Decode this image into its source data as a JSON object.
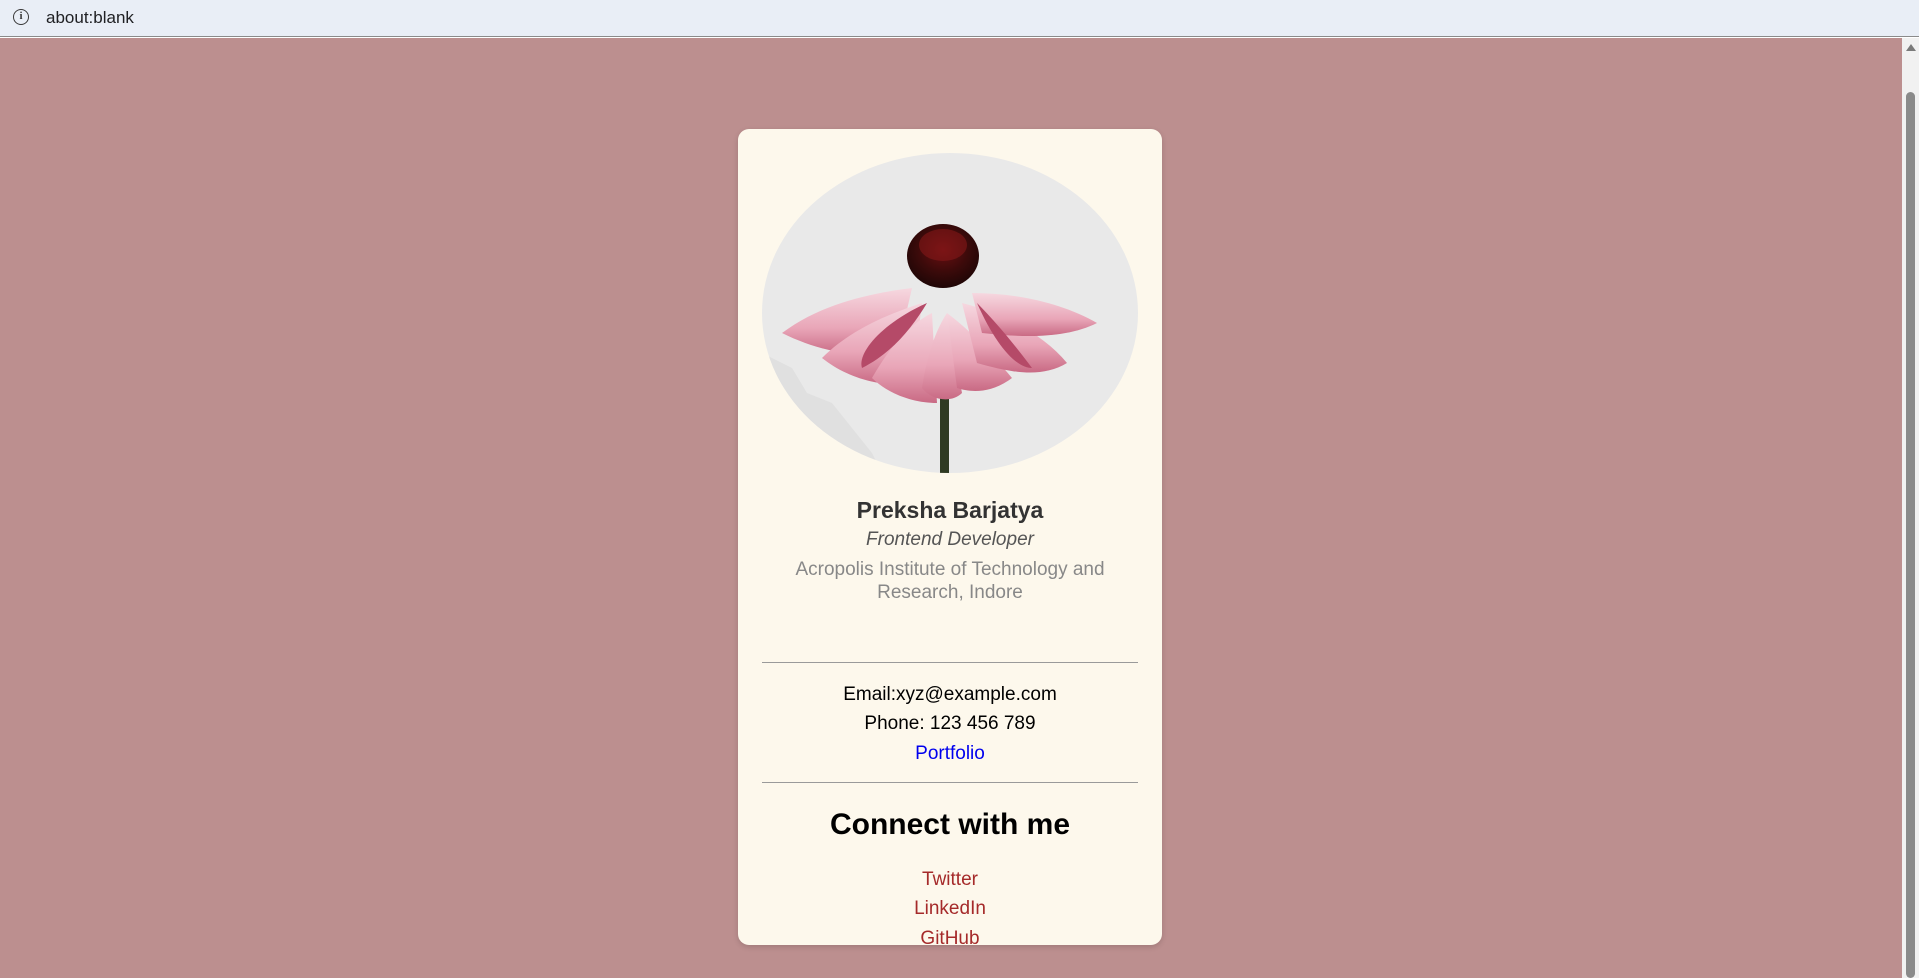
{
  "browser": {
    "address": "about:blank"
  },
  "colors": {
    "page_background": "#bc8f8f",
    "card_background": "#fdf8ec",
    "social_link": "#a52a2a",
    "portfolio_link": "#0000ee"
  },
  "profile": {
    "photo_icon": "flower-photo",
    "name": "Preksha Barjatya",
    "role": "Frontend Developer",
    "institute": "Acropolis Institute of Technology and Research, Indore"
  },
  "contact": {
    "email": "Email:xyz@example.com",
    "phone": "Phone: 123 456 789",
    "portfolio_label": "Portfolio"
  },
  "social": {
    "title": "Connect with me",
    "links": [
      {
        "label": "Twitter"
      },
      {
        "label": "LinkedIn"
      },
      {
        "label": "GitHub"
      }
    ]
  }
}
